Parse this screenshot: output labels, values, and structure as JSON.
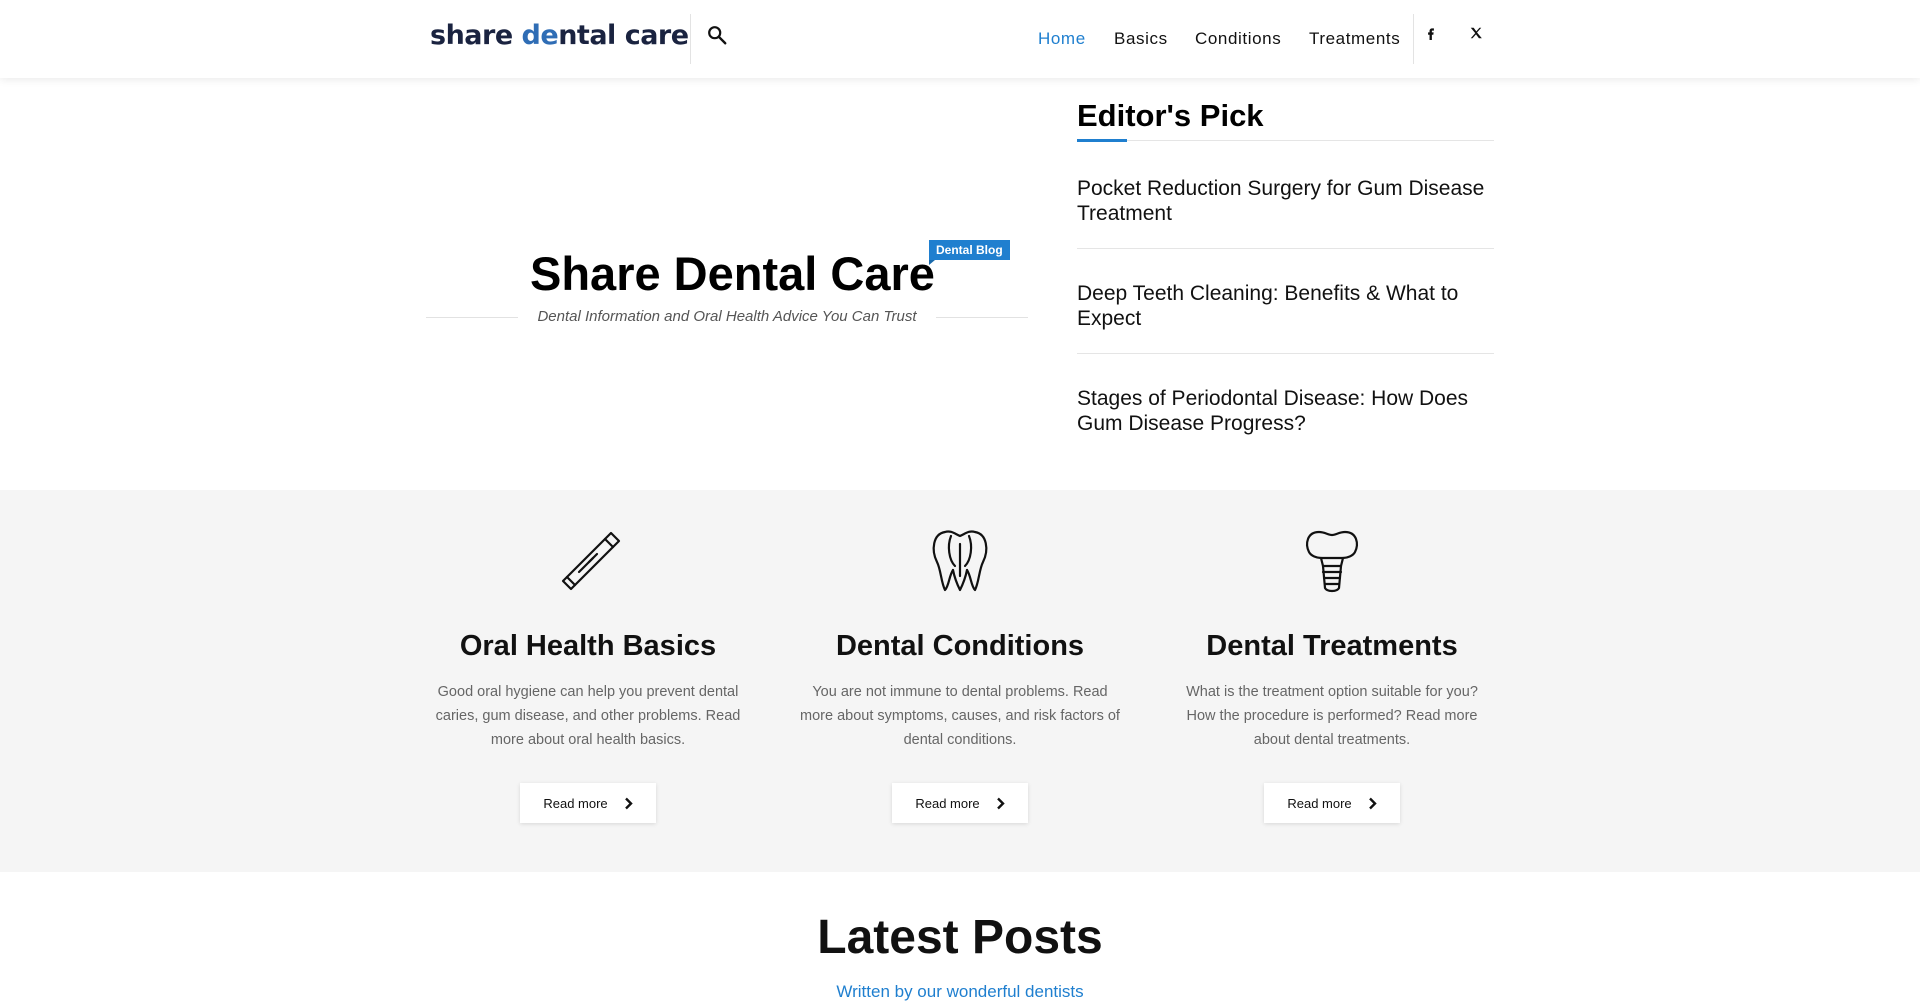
{
  "header": {
    "logo_text_start": "share ",
    "logo_text_accent": "de",
    "logo_text_end": "ntal care",
    "nav": [
      "Home",
      "Basics",
      "Conditions",
      "Treatments"
    ],
    "active_nav": "Home",
    "social": [
      "facebook-icon",
      "x-twitter-icon"
    ]
  },
  "hero": {
    "title": "Share Dental Care",
    "badge": "Dental Blog",
    "tagline": "Dental Information and Oral Health Advice You Can Trust"
  },
  "editors_pick": {
    "title": "Editor's Pick",
    "items": [
      "Pocket Reduction Surgery for Gum Disease Treatment",
      "Deep Teeth Cleaning: Benefits & What to Expect",
      "Stages of Periodontal Disease: How Does Gum Disease Progress?"
    ]
  },
  "categories": [
    {
      "icon": "toothpaste-tube-icon",
      "title": "Oral Health Basics",
      "description": "Good oral hygiene can help you prevent dental caries, gum disease, and other problems. Read more about oral health basics.",
      "button": "Read more"
    },
    {
      "icon": "tooth-roots-icon",
      "title": "Dental Conditions",
      "description": "You are not immune to dental problems. Read more about symptoms, causes, and risk factors of dental conditions.",
      "button": "Read more"
    },
    {
      "icon": "dental-implant-icon",
      "title": "Dental Treatments",
      "description": "What is the treatment option suitable for you? How the procedure is performed? Read more about dental treatments.",
      "button": "Read more"
    }
  ],
  "latest": {
    "title": "Latest Posts",
    "subtitle": "Written by our wonderful dentists"
  },
  "colors": {
    "accent": "#1f7fcf",
    "logo_dark": "#1a2340",
    "band_bg": "#f5f5f5"
  }
}
